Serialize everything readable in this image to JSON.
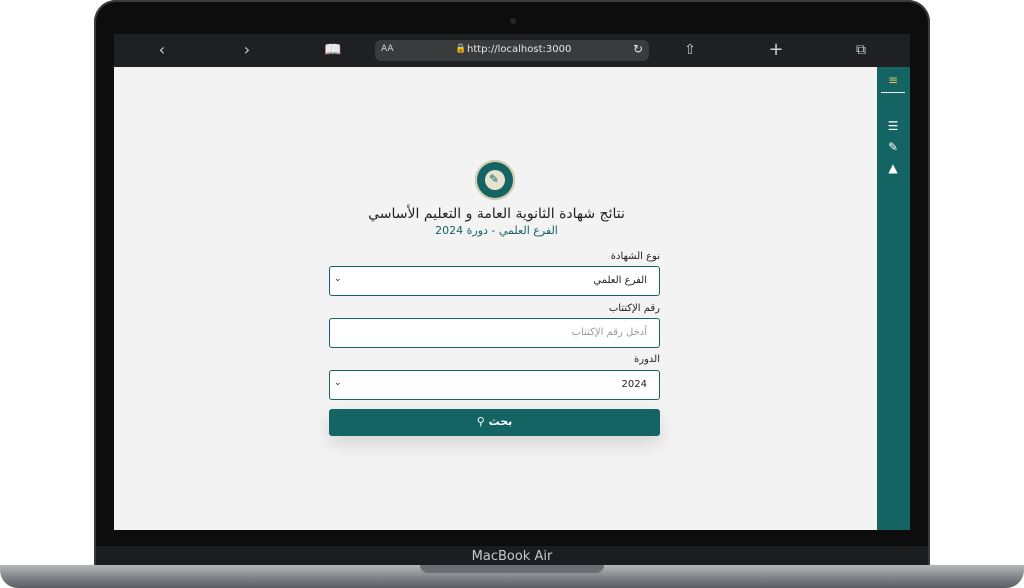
{
  "device": {
    "brand": "MacBook Air"
  },
  "browser": {
    "url": "http://localhost:3000",
    "reader_label": "AA"
  },
  "page": {
    "title": "نتائج شهادة الثانوية العامة و التعليم الأساسي",
    "subtitle": "الفرع العلمي - دورة 2024",
    "certificate_type": {
      "label": "نوع الشهادة",
      "value": "الفرع العلمي"
    },
    "registration_number": {
      "label": "رقم الإكتتاب",
      "placeholder": "أدخل رقم الإكتتاب"
    },
    "session": {
      "label": "الدورة",
      "value": "2024"
    },
    "search_button": {
      "label": "بحث"
    }
  },
  "colors": {
    "accent": "#156464",
    "page_background": "#f3f3f3"
  },
  "sidebar_icons": [
    "menu-icon",
    "list-icon",
    "pen-icon",
    "graduation-cap-icon"
  ]
}
